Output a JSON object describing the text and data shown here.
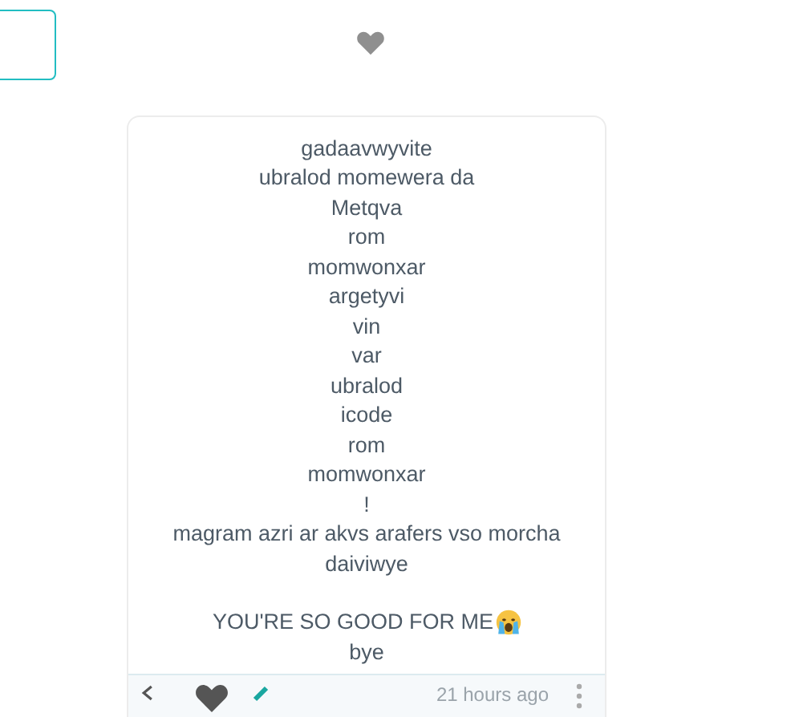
{
  "post": {
    "paragraphs": [
      {
        "lines": [
          {
            "text": "gadaavwyvite",
            "kind": "plain"
          },
          {
            "text": "ubralod momewera da",
            "kind": "plain"
          },
          {
            "text": "Metqva",
            "kind": "plain"
          },
          {
            "text": "rom",
            "kind": "plain"
          },
          {
            "text": "momwonxar",
            "kind": "plain"
          },
          {
            "text": "argetyvi",
            "kind": "plain"
          },
          {
            "text": "vin",
            "kind": "plain"
          },
          {
            "text": "var",
            "kind": "plain"
          },
          {
            "text": "ubralod",
            "kind": "plain"
          },
          {
            "text": "icode",
            "kind": "plain"
          },
          {
            "text": "rom",
            "kind": "plain"
          },
          {
            "text": "momwonxar",
            "kind": "plain"
          },
          {
            "text": "!",
            "kind": "plain"
          },
          {
            "text": "magram azri ar akvs arafers vso morcha",
            "kind": "plain"
          },
          {
            "text": "daiviwye",
            "kind": "plain"
          }
        ]
      },
      {
        "lines": [
          {
            "text": "YOU'RE SO GOOD FOR ME",
            "kind": "with-emoji"
          },
          {
            "text": "bye",
            "kind": "plain"
          }
        ]
      }
    ],
    "time": "21 hours ago"
  }
}
